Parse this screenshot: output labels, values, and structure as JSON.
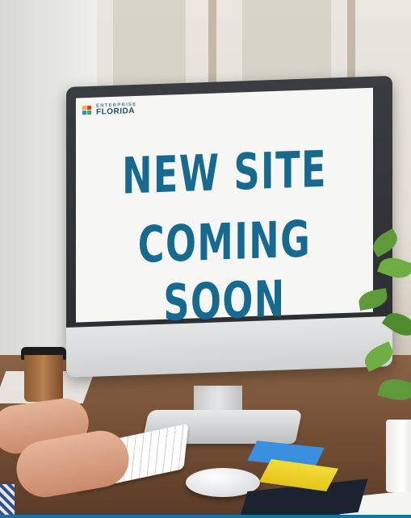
{
  "screen": {
    "logo": {
      "top": "ENTERPRISE",
      "bottom": "FLORIDA",
      "mark": "florida-logo-icon"
    },
    "headline_line1": "NEW SITE",
    "headline_line2": "COMING SOON"
  },
  "colors": {
    "headline": "#176a8f",
    "logo": "#1d4f6d",
    "accent_bar": "#1f6f9a"
  }
}
